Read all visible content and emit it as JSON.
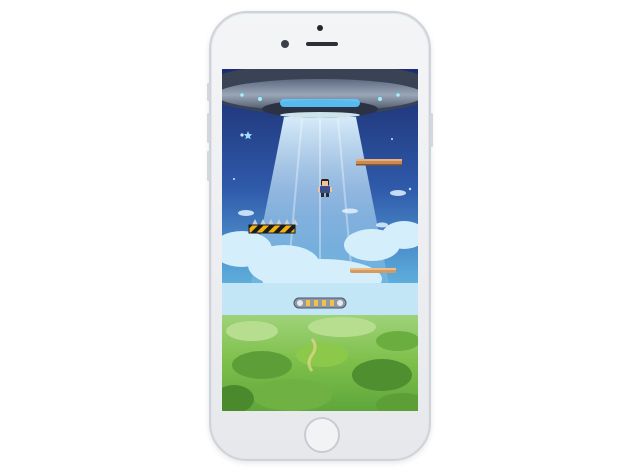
{
  "device": {
    "model": "smartphone",
    "color": "#eceef1"
  },
  "game": {
    "scene": "ufo-abduction-jump",
    "player": {
      "state": "jumping"
    },
    "platforms": [
      {
        "type": "wooden",
        "variant": "plank"
      },
      {
        "type": "spiked",
        "variant": "hazard-stripes"
      },
      {
        "type": "wooden",
        "variant": "plank"
      },
      {
        "type": "conveyor",
        "variant": "belt"
      }
    ],
    "colors": {
      "sky_top": "#1c2c6e",
      "sky_mid": "#3a72c4",
      "sky_low": "#6fc6e6",
      "beam": "#bfe8ff",
      "hazard": "#f2b20e",
      "grass": "#8cc94a"
    }
  }
}
